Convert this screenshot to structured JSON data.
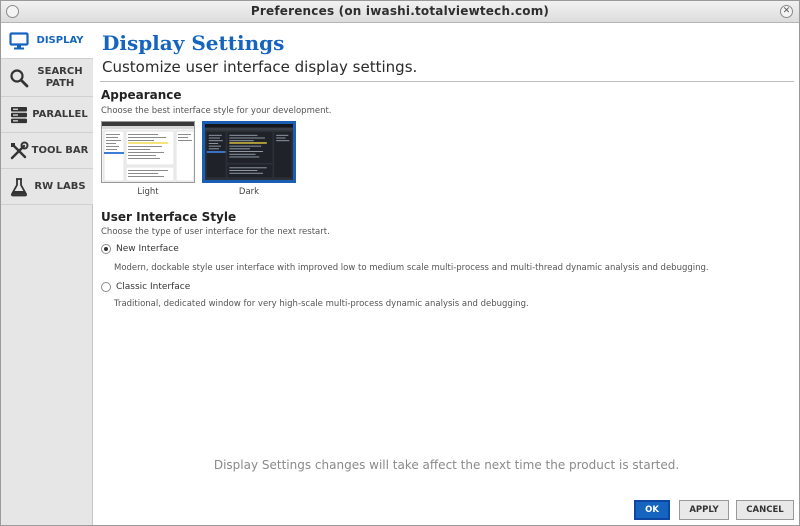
{
  "window": {
    "title": "Preferences (on iwashi.totalviewtech.com)"
  },
  "sidebar": {
    "items": [
      {
        "label_line1": "DISPLAY",
        "label_line2": "",
        "icon": "monitor-icon",
        "active": true
      },
      {
        "label_line1": "SEARCH",
        "label_line2": "PATH",
        "icon": "magnifier-icon",
        "active": false
      },
      {
        "label_line1": "PARALLEL",
        "label_line2": "",
        "icon": "server-stack-icon",
        "active": false
      },
      {
        "label_line1": "TOOL BAR",
        "label_line2": "",
        "icon": "tools-icon",
        "active": false
      },
      {
        "label_line1": "RW LABS",
        "label_line2": "",
        "icon": "flask-icon",
        "active": false
      }
    ]
  },
  "main": {
    "title": "Display Settings",
    "subtitle": "Customize user interface display settings.",
    "appearance": {
      "heading": "Appearance",
      "description": "Choose the best interface style for your development.",
      "themes": [
        {
          "label": "Light",
          "selected": false
        },
        {
          "label": "Dark",
          "selected": true
        }
      ]
    },
    "ui_style": {
      "heading": "User Interface Style",
      "description": "Choose the type of user interface for the next restart.",
      "options": [
        {
          "label": "New Interface",
          "checked": true,
          "description": "Modern, dockable style user interface with improved low to medium scale multi-process and multi-thread dynamic analysis and debugging."
        },
        {
          "label": "Classic Interface",
          "checked": false,
          "description": "Traditional, dedicated window for very high-scale multi-process dynamic analysis and debugging."
        }
      ]
    },
    "notice": "Display Settings changes will take affect the next time the product is started."
  },
  "buttons": {
    "ok": "OK",
    "apply": "APPLY",
    "cancel": "CANCEL"
  },
  "colors": {
    "accent": "#1565c0",
    "sidebar_bg": "#e6e6e6"
  }
}
